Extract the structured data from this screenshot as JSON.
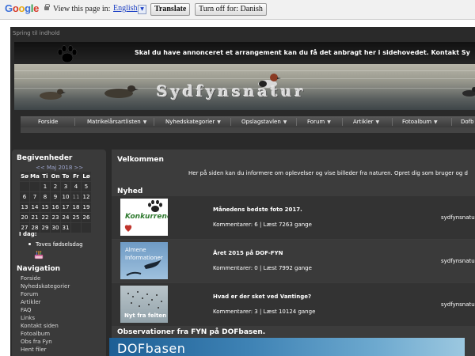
{
  "translate_bar": {
    "logo_letters": [
      "G",
      "o",
      "o",
      "g",
      "l",
      "e"
    ],
    "view_text": "View this page in:",
    "language": "English",
    "translate_label": "Translate",
    "turn_off_label": "Turn off for: Danish"
  },
  "skip_link": "Spring til indhold",
  "header": {
    "marquee": "Skal du have annonceret et arrangement kan du få det anbragt her i sidehovedet.  Kontakt Sy",
    "site_title": "Sydfynsnatur"
  },
  "nav": {
    "items": [
      {
        "label": "Forside",
        "dropdown": false
      },
      {
        "label": "Matrikelårsartlisten",
        "dropdown": true
      },
      {
        "label": "Nyhedskategorier",
        "dropdown": true
      },
      {
        "label": "Opslagstavlen",
        "dropdown": true
      },
      {
        "label": "Forum",
        "dropdown": true
      },
      {
        "label": "Artikler",
        "dropdown": true
      },
      {
        "label": "Fotoalbum",
        "dropdown": true
      },
      {
        "label": "Dofb",
        "dropdown": false
      }
    ]
  },
  "sidebar": {
    "events_title": "Begivenheder",
    "calendar_nav": "<< Maj 2018 >>",
    "calendar_header": [
      "Sø",
      "Ma",
      "Ti",
      "On",
      "To",
      "Fr",
      "Lø"
    ],
    "calendar_weeks": [
      [
        "",
        "",
        "1",
        "2",
        "3",
        "4",
        "5"
      ],
      [
        "6",
        "7",
        "8",
        "9",
        "10",
        "11",
        "12"
      ],
      [
        "13",
        "14",
        "15",
        "16",
        "17",
        "18",
        "19"
      ],
      [
        "20",
        "21",
        "22",
        "23",
        "24",
        "25",
        "26"
      ],
      [
        "27",
        "28",
        "29",
        "30",
        "31",
        "",
        ""
      ]
    ],
    "today_label": "I dag:",
    "birthday": "Toves fødselsdag",
    "navigation_title": "Navigation",
    "nav_links": [
      "Forside",
      "Nyhedskategorier",
      "Forum",
      "Artikler",
      "FAQ",
      "Links",
      "Kontakt siden",
      "Fotoalbum",
      "Obs fra Fyn",
      "Hent filer"
    ]
  },
  "main": {
    "welcome_title": "Velkommen",
    "intro": "Her på siden kan du informere om oplevelser og vise billeder fra naturen. Opret dig som bruger og d",
    "news_title": "Nyhed",
    "news": [
      {
        "title": "Månedens bedste foto 2017.",
        "meta": "Kommentarer: 6 | Læst 7263 gange",
        "author": "sydfynsnatu",
        "thumb_text": "Konkurrence"
      },
      {
        "title": "Året 2015 på DOF-FYN",
        "meta": "Kommentarer: 0 | Læst 7992 gange",
        "author": "sydfynsnatu",
        "thumb_text_1": "Almene",
        "thumb_text_2": "Informationer"
      },
      {
        "title": "Hvad er der sket ved Vantinge?",
        "meta": "Kommentarer: 3 | Læst 10124 gange",
        "author": "sydfynsnatu",
        "thumb_text": "Nyt fra felten"
      }
    ],
    "observations_title": "Observationer fra FYN på DOFbasen.",
    "dof_title": "DOFbasen"
  }
}
